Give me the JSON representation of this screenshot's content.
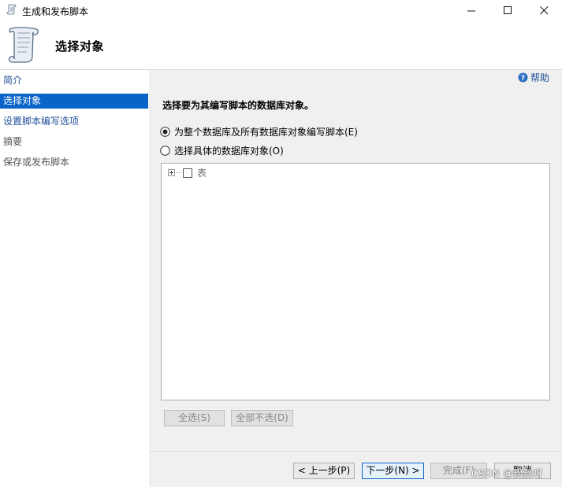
{
  "window": {
    "title": "生成和发布脚本",
    "controls": {
      "minimize": "minimize-icon",
      "maximize": "maximize-icon",
      "close": "close-icon"
    }
  },
  "header": {
    "title": "选择对象",
    "icon": "scroll-icon"
  },
  "sidebar": {
    "items": [
      {
        "label": "简介",
        "state": "link"
      },
      {
        "label": "选择对象",
        "state": "selected"
      },
      {
        "label": "设置脚本编写选项",
        "state": "link"
      },
      {
        "label": "摘要",
        "state": "disabled"
      },
      {
        "label": "保存或发布脚本",
        "state": "disabled"
      }
    ]
  },
  "main": {
    "help_label": "帮助",
    "prompt": "选择要为其编写脚本的数据库对象。",
    "options": [
      {
        "label": "为整个数据库及所有数据库对象编写脚本(E)",
        "checked": true
      },
      {
        "label": "选择具体的数据库对象(O)",
        "checked": false
      }
    ],
    "tree": {
      "items": [
        {
          "label": "表",
          "checked": false,
          "expanded": false
        }
      ]
    },
    "select_all_label": "全选(S)",
    "deselect_all_label": "全部不选(D)"
  },
  "footer": {
    "prev_label": "< 上一步(P)",
    "next_label": "下一步(N) >",
    "finish_label": "完成(F)",
    "cancel_label": "取消"
  },
  "watermark": "CSDN @飘飘呀",
  "colors": {
    "accent": "#0a64c8",
    "link": "#1f4e9a",
    "panel": "#f0f0f0"
  }
}
